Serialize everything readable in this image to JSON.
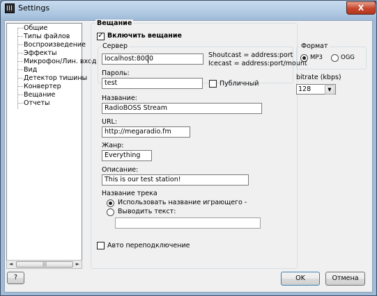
{
  "window": {
    "title": "Settings",
    "close_label": "X"
  },
  "sidebar": {
    "items": [
      {
        "label": "Общие"
      },
      {
        "label": "Типы файлов"
      },
      {
        "label": "Воспроизведение"
      },
      {
        "label": "Эффекты"
      },
      {
        "label": "Микрофон/Лин. вход"
      },
      {
        "label": "Вид"
      },
      {
        "label": "Детектор тишины"
      },
      {
        "label": "Конвертер"
      },
      {
        "label": "Вещание"
      },
      {
        "label": "Отчеты"
      }
    ],
    "scroll_left": "◄",
    "scroll_right": "►",
    "thumb_grip": "|||"
  },
  "broadcast": {
    "group_title": "Вещание",
    "enable_label": "Включить вещание",
    "enable_checked": true,
    "server": {
      "legend": "Сервер",
      "value": "localhost:8000",
      "hint_shoutcast": "Shoutcast = address:port",
      "hint_icecast": "Icecast = address:port/mount"
    },
    "password": {
      "label": "Пароль:",
      "value": "test"
    },
    "public": {
      "label": "Публичный",
      "checked": false
    },
    "name": {
      "label": "Название:",
      "value": "RadioBOSS Stream"
    },
    "url": {
      "label": "URL:",
      "value": "http://megaradio.fm"
    },
    "genre": {
      "label": "Жанр:",
      "value": "Everything"
    },
    "description": {
      "label": "Описание:",
      "value": "This is our test station!"
    },
    "track_title": {
      "label": "Название трека",
      "option_use_playing": "Использовать название играющего -",
      "option_custom": "Выводить текст:",
      "selected": "use_playing",
      "custom_value": ""
    },
    "auto_reconnect": {
      "label": "Авто переподключение",
      "checked": false
    }
  },
  "format": {
    "legend": "Формат",
    "options": [
      "MP3",
      "OGG"
    ],
    "selected": "MP3"
  },
  "bitrate": {
    "label": "bitrate (kbps)",
    "value": "128"
  },
  "buttons": {
    "help": "?",
    "ok": "OK",
    "cancel": "Отмена"
  }
}
